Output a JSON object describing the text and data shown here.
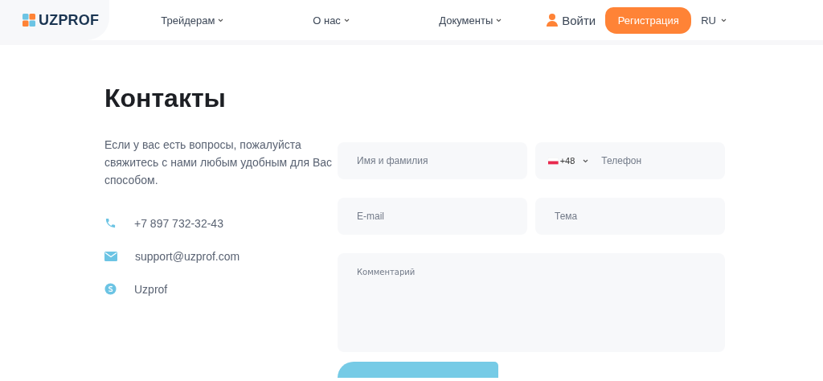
{
  "header": {
    "logo": "UZPROF",
    "nav": [
      {
        "label": "Трейдерам",
        "has_menu": true
      },
      {
        "label": "О нас",
        "has_menu": true
      },
      {
        "label": "Документы",
        "has_menu": true
      }
    ],
    "login": "Войти",
    "register": "Регистрация",
    "language": {
      "label": "RU",
      "has_menu": true
    }
  },
  "title": "Контакты",
  "intro": "Если у вас есть вопросы, пожалуйста свяжитесь с нами любым удобным для Вас способом.",
  "contacts": [
    {
      "kind": "phone",
      "text": "+7 897 732-32-43"
    },
    {
      "kind": "email",
      "text": "support@uzprof.com"
    },
    {
      "kind": "skype",
      "text": "Uzprof"
    }
  ],
  "form": {
    "fields": [
      {
        "kind": "text",
        "placeholder": "Имя и фамилия"
      },
      {
        "kind": "phone",
        "code": "+48",
        "placeholder": "Телефон"
      },
      {
        "kind": "text",
        "placeholder": "E-mail"
      },
      {
        "kind": "text",
        "placeholder": "Тема"
      },
      {
        "kind": "textarea",
        "placeholder": "Комментарий"
      }
    ]
  }
}
